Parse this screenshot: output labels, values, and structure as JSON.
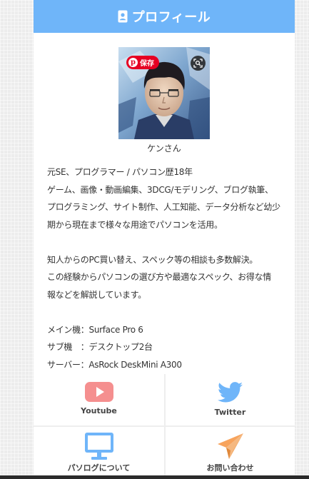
{
  "header": {
    "title": "プロフィール",
    "icon": "id-card-icon",
    "bg_color": "#6fb5f9"
  },
  "avatar": {
    "alt": "profile photo",
    "save_button_label": "保存",
    "pin_icon": "pinterest-icon",
    "lens_icon": "visual-search-icon"
  },
  "profile": {
    "name": "ケンさん",
    "bio_paragraph_1": [
      "元SE、プログラマー / パソコン歴18年",
      "ゲーム、画像・動画編集、3DCG/モデリング、ブログ執筆、",
      "プログラミング、サイト制作、人工知能、データ分析など幼少",
      "期から現在まで様々な用途でパソコンを活用。"
    ],
    "bio_paragraph_2": [
      "知人からのPC買い替え、スペック等の相談も多数解決。",
      "この経験からパソコンの選び方や最適なスペック、お得な情",
      "報などを解説しています。"
    ],
    "specs": [
      "メイン機：Surface Pro 6",
      "サブ機　：デスクトップ2台",
      "サーバー：AsRock DeskMini A300"
    ]
  },
  "links": [
    {
      "label": "Youtube",
      "icon": "youtube-icon",
      "color": "#f58f8f"
    },
    {
      "label": "Twitter",
      "icon": "twitter-icon",
      "color": "#6fb5f9"
    },
    {
      "label": "パソログについて",
      "icon": "monitor-icon",
      "color": "#6fb5f9"
    },
    {
      "label": "お問い合わせ",
      "icon": "paper-plane-icon",
      "color": "#f7a35c"
    }
  ]
}
